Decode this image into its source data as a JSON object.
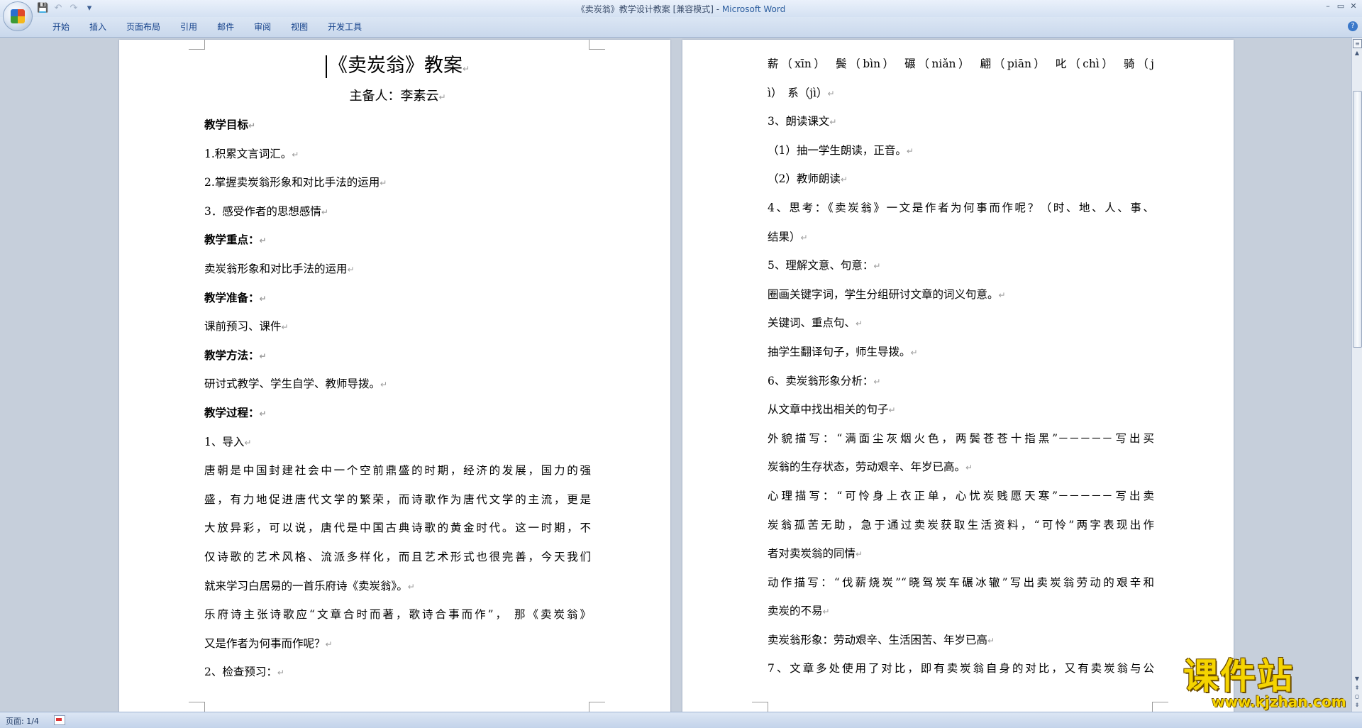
{
  "titlebar": {
    "doc_name": "《卖炭翁》教学设计教案 [兼容模式] - ",
    "app_name": "Microsoft Word",
    "qat_save": "💾",
    "qat_undo": "↶",
    "qat_redo": "↷",
    "qat_more": "▾",
    "win_min": "–",
    "win_max": "▭",
    "win_close": "✕"
  },
  "ribbon": {
    "tabs": [
      "开始",
      "插入",
      "页面布局",
      "引用",
      "邮件",
      "审阅",
      "视图",
      "开发工具"
    ],
    "help": "?"
  },
  "left_page": {
    "title": "《卖炭翁》教案",
    "subtitle": "主备人：李素云",
    "lines": [
      "教学目标",
      "1.积累文言词汇。",
      "2.掌握卖炭翁形象和对比手法的运用",
      "3．感受作者的思想感情",
      "教学重点：",
      "卖炭翁形象和对比手法的运用",
      "教学准备：",
      "课前预习、课件",
      "教学方法：",
      "研讨式教学、学生自学、教师导拨。",
      "教学过程：",
      "1、导入",
      "唐朝是中国封建社会中一个空前鼎盛的时期，经济的发展，国力的强",
      "盛，有力地促进唐代文学的繁荣，而诗歌作为唐代文学的主流，更是",
      "大放异彩，可以说，唐代是中国古典诗歌的黄金时代。这一时期，不",
      "仅诗歌的艺术风格、流派多样化，而且艺术形式也很完善，今天我们",
      "就来学习白居易的一首乐府诗《卖炭翁》。",
      "乐府诗主张诗歌应“文章合时而著，歌诗合事而作”， 那《卖炭翁》",
      "又是作者为何事而作呢？",
      "2、检查预习："
    ]
  },
  "right_page": {
    "lines": [
      "薪（xīn）　鬓（bìn）　碾（niǎn）　翩（piān）　叱（chì）　骑（j",
      "ì）　系（jì）",
      "3、朗读课文",
      "（1）抽一学生朗读，正音。",
      "（2）教师朗读",
      "4、思考：《卖炭翁》一文是作者为何事而作呢？（时、地、人、事、",
      "结果）",
      "5、理解文意、句意：",
      "圈画关键字词，学生分组研讨文章的词义句意。",
      "关键词、重点句、",
      "抽学生翻译句子，师生导拨。",
      "6、卖炭翁形象分析：",
      "从文章中找出相关的句子",
      "外貌描写：“满面尘灰烟火色，两鬓苍苍十指黑”－－－－－写出买",
      "炭翁的生存状态，劳动艰辛、年岁已高。",
      "心理描写：“可怜身上衣正单，心忧炭贱愿天寒”－－－－－写出卖",
      "炭翁孤苦无助，急于通过卖炭获取生活资料，“可怜”两字表现出作",
      "者对卖炭翁的同情",
      "动作描写：“伐薪烧炭”“晓驾炭车碾冰辙”写出卖炭翁劳动的艰辛和",
      "卖炭的不易",
      "卖炭翁形象：劳动艰辛、生活困苦、年岁已高",
      "7、文章多处使用了对比，即有卖炭翁自身的对比，又有卖炭翁与公"
    ]
  },
  "statusbar": {
    "page_info": "页面: 1/4"
  },
  "watermark": {
    "name": "课件站",
    "url": "www.kjzhan.com"
  },
  "scrollbar": {
    "up": "▲",
    "down": "▼",
    "prev": "⇞",
    "select": "○",
    "next": "⇟",
    "ruler": "≡"
  }
}
